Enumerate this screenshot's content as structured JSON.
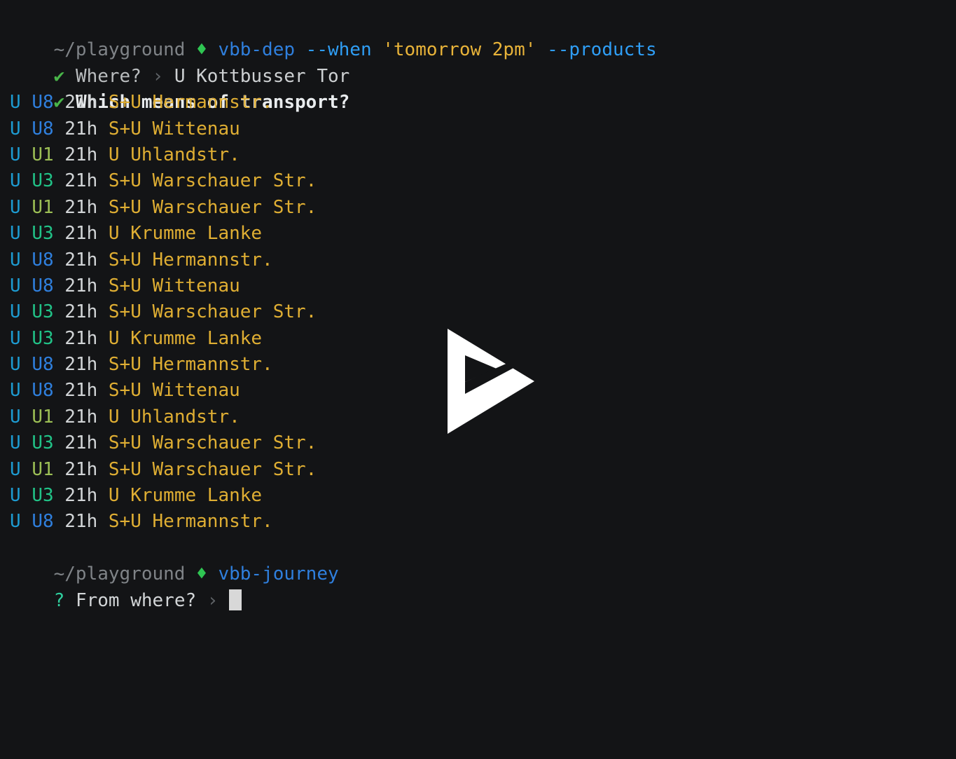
{
  "terminal": {
    "background_color": "#131416",
    "foreground_color": "#d6d6d6",
    "cursor_color": "#d8d8d8"
  },
  "prompt": {
    "path": "~/playground",
    "symbol": "♦",
    "command": "vbb-dep",
    "flag_when": "--when",
    "arg_when": "'tomorrow 2pm'",
    "flag_products": "--products"
  },
  "answered_prompts": [
    {
      "check": "✔",
      "question": "Where?",
      "chevron": "›",
      "answer": "U Kottbusser Tor",
      "bold": false
    },
    {
      "check": "✔",
      "question": "Which means of transport?",
      "chevron": "",
      "answer": "",
      "bold": true
    }
  ],
  "departures_header": {
    "mode_column": "U",
    "time_column": "21h"
  },
  "departures": [
    {
      "mode": "U",
      "line": "U8",
      "line_color": "#2f7fdd",
      "time": "21h",
      "destination": "S+U Hermannstr."
    },
    {
      "mode": "U",
      "line": "U8",
      "line_color": "#2f7fdd",
      "time": "21h",
      "destination": "S+U Wittenau"
    },
    {
      "mode": "U",
      "line": "U1",
      "line_color": "#9cbf55",
      "time": "21h",
      "destination": "U Uhlandstr."
    },
    {
      "mode": "U",
      "line": "U3",
      "line_color": "#21c287",
      "time": "21h",
      "destination": "S+U Warschauer Str."
    },
    {
      "mode": "U",
      "line": "U1",
      "line_color": "#9cbf55",
      "time": "21h",
      "destination": "S+U Warschauer Str."
    },
    {
      "mode": "U",
      "line": "U3",
      "line_color": "#21c287",
      "time": "21h",
      "destination": "U Krumme Lanke"
    },
    {
      "mode": "U",
      "line": "U8",
      "line_color": "#2f7fdd",
      "time": "21h",
      "destination": "S+U Hermannstr."
    },
    {
      "mode": "U",
      "line": "U8",
      "line_color": "#2f7fdd",
      "time": "21h",
      "destination": "S+U Wittenau"
    },
    {
      "mode": "U",
      "line": "U3",
      "line_color": "#21c287",
      "time": "21h",
      "destination": "S+U Warschauer Str."
    },
    {
      "mode": "U",
      "line": "U3",
      "line_color": "#21c287",
      "time": "21h",
      "destination": "U Krumme Lanke"
    },
    {
      "mode": "U",
      "line": "U8",
      "line_color": "#2f7fdd",
      "time": "21h",
      "destination": "S+U Hermannstr."
    },
    {
      "mode": "U",
      "line": "U8",
      "line_color": "#2f7fdd",
      "time": "21h",
      "destination": "S+U Wittenau"
    },
    {
      "mode": "U",
      "line": "U1",
      "line_color": "#9cbf55",
      "time": "21h",
      "destination": "U Uhlandstr."
    },
    {
      "mode": "U",
      "line": "U3",
      "line_color": "#21c287",
      "time": "21h",
      "destination": "S+U Warschauer Str."
    },
    {
      "mode": "U",
      "line": "U1",
      "line_color": "#9cbf55",
      "time": "21h",
      "destination": "S+U Warschauer Str."
    },
    {
      "mode": "U",
      "line": "U3",
      "line_color": "#21c287",
      "time": "21h",
      "destination": "U Krumme Lanke"
    },
    {
      "mode": "U",
      "line": "U8",
      "line_color": "#2f7fdd",
      "time": "21h",
      "destination": "S+U Hermannstr."
    }
  ],
  "second_prompt": {
    "path": "~/playground",
    "symbol": "♦",
    "command": "vbb-journey"
  },
  "active_question": {
    "marker": "?",
    "question": "From where?",
    "chevron": "›",
    "input_value": ""
  },
  "logo": {
    "name": "play-triangle-logo",
    "color": "#ffffff"
  }
}
